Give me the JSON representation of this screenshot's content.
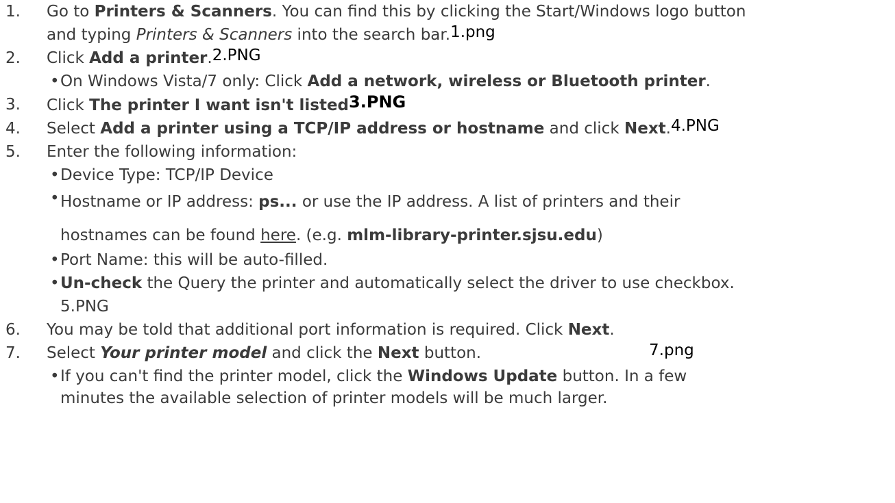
{
  "steps": [
    {
      "num": "1.",
      "parts": [
        "Go to ",
        "Printers & Scanners",
        ". You can find this by clicking the Start/Windows logo button"
      ],
      "line2": [
        "and typing ",
        "Printers & Scanners",
        " into the search bar."
      ],
      "image": "1.png"
    },
    {
      "num": "2.",
      "parts": [
        "Click ",
        "Add a printer",
        "."
      ],
      "image": "2.PNG",
      "sub": [
        {
          "parts": [
            "On Windows Vista/7 only: Click ",
            "Add a network, wireless or Bluetooth printer",
            "."
          ]
        }
      ]
    },
    {
      "num": "3.",
      "parts": [
        "Click ",
        "The printer I want isn't listed"
      ],
      "image": "3.PNG"
    },
    {
      "num": "4.",
      "parts": [
        "Select ",
        "Add a printer using a TCP/IP address or hostname",
        " and click ",
        "Next",
        "."
      ],
      "image": "4.PNG"
    },
    {
      "num": "5.",
      "parts": [
        "Enter the following information:"
      ],
      "sub": [
        {
          "parts": [
            "Device Type: TCP/IP Device"
          ]
        },
        {
          "parts": [
            "Hostname or IP address: ",
            "ps...",
            " or use the IP address. A list of printers and their"
          ],
          "line2": [
            "hostnames can be found ",
            "here",
            ". (e.g. ",
            "mlm-library-printer.sjsu.edu",
            ")"
          ]
        },
        {
          "parts": [
            "Port Name: this will be auto-filled."
          ]
        },
        {
          "parts": [
            "Un-check",
            " the Query the printer and automatically select the driver to use checkbox."
          ],
          "image": "5.PNG"
        }
      ]
    },
    {
      "num": "6.",
      "parts": [
        "You may be told that additional port information is required. Click ",
        "Next",
        "."
      ]
    },
    {
      "num": "7.",
      "parts": [
        "Select ",
        "Your printer model",
        " and click the ",
        "Next",
        " button."
      ],
      "image": "7.png",
      "sub": [
        {
          "parts": [
            "If you can't find the printer model, click the ",
            "Windows Update",
            " button. In a few"
          ],
          "line2": [
            "minutes the available selection of printer models will be much larger."
          ]
        }
      ]
    }
  ],
  "bullet": "•"
}
